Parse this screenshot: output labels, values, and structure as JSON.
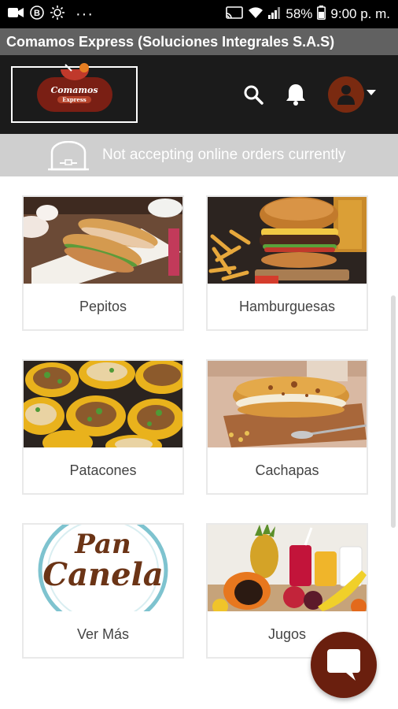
{
  "status_bar": {
    "battery": "58%",
    "time": "9:00 p. m.",
    "dots": "···",
    "icons": [
      "video-camera-icon",
      "b-badge-icon",
      "brightness-icon",
      "cast-icon",
      "wifi-icon",
      "signal-icon",
      "battery-icon"
    ]
  },
  "app": {
    "title": "Comamos Express (Soluciones Integrales S.A.S)"
  },
  "header": {
    "logo_text": "Comamos",
    "logo_sub": "Express",
    "icons": [
      "search-icon",
      "bell-icon",
      "user-avatar-icon",
      "caret-down-icon"
    ]
  },
  "notice": {
    "text": "Not accepting online orders currently",
    "icon": "closed-store-icon"
  },
  "categories": [
    {
      "label": "Pepitos"
    },
    {
      "label": "Hamburguesas"
    },
    {
      "label": "Patacones"
    },
    {
      "label": "Cachapas"
    },
    {
      "label": "Ver Más",
      "image_text_1": "Pan",
      "image_text_2": "Canela"
    },
    {
      "label": "Jugos"
    }
  ],
  "colors": {
    "header_bg": "#1b1b1b",
    "title_bar": "#616161",
    "accent": "#7a2a10",
    "notice_bg": "#cfcfcf"
  }
}
